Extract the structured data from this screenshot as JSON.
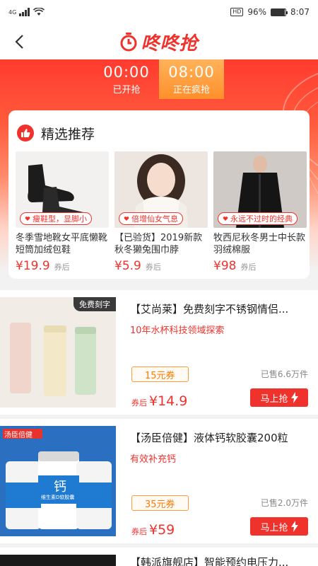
{
  "status_bar": {
    "network": "4G",
    "hd": "HD",
    "battery": "96%",
    "battery_level": 0.96,
    "time": "8:07"
  },
  "header": {
    "logo_text": "咚咚抢"
  },
  "tabs": [
    {
      "time": "00:00",
      "label": "已开抢",
      "active": false
    },
    {
      "time": "08:00",
      "label": "正在疯抢",
      "active": true
    }
  ],
  "recommend": {
    "title": "精选推荐",
    "items": [
      {
        "tag": "瘦鞋型，显脚小",
        "name": "冬季雪地靴女平底懒靴短筒加绒包鞋",
        "price": "¥19.9",
        "suffix": "券后"
      },
      {
        "tag": "倍增仙女气息",
        "name": "【已验货】2019新款秋冬獭兔围巾脖",
        "price": "¥5.9",
        "suffix": "券后"
      },
      {
        "tag": "永远不过时的经典",
        "name": "牧西尼秋冬男士中长款羽绒棉服",
        "price": "¥98",
        "suffix": "券后"
      }
    ]
  },
  "products": [
    {
      "badge": "免费刻字",
      "title": "【艾尚莱】免费刻字不锈钢情侣...",
      "subtitle": "10年水杯科技领域探索",
      "coupon": "15元券",
      "sold": "已售6.6万件",
      "price_prefix": "券后",
      "price": "¥14.9",
      "buy": "马上抢"
    },
    {
      "badge": "",
      "title": "【汤臣倍健】液体钙软胶囊200粒",
      "subtitle": "有效补充钙",
      "coupon": "35元券",
      "sold": "已售2.0万件",
      "price_prefix": "券后",
      "price": "¥59",
      "buy": "马上抢",
      "brand_mark": "汤臣倍健",
      "pack_text": "钙",
      "pack_sub": "维生素D软胶囊"
    },
    {
      "badge": "",
      "title": "【韩派旗舰店】智能预约电压力...",
      "subtitle": "",
      "coupon": "",
      "sold": "",
      "price_prefix": "",
      "price": "",
      "buy": ""
    }
  ]
}
